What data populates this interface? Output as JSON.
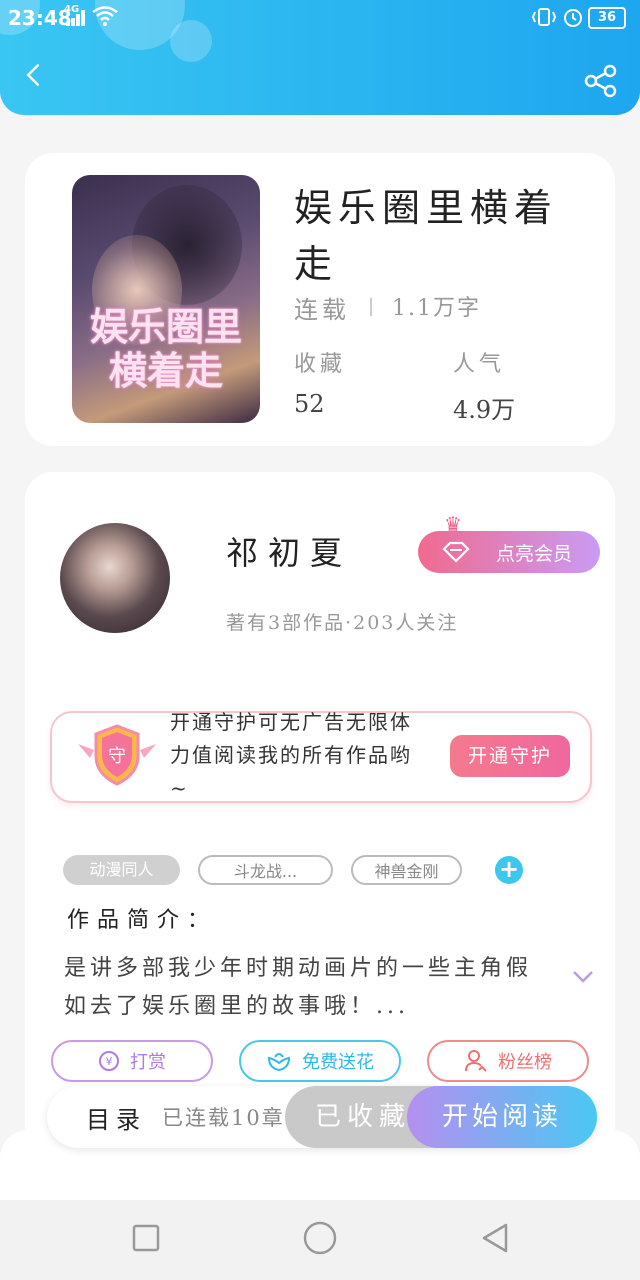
{
  "status_bar": {
    "time": "23:48",
    "network": "4G",
    "battery": "36"
  },
  "book": {
    "cover_title": "娱乐圈里横着走",
    "title": "娱乐圈里横着走",
    "status": "连载",
    "word_count": "1.1万字",
    "stats": {
      "favorites_label": "收藏",
      "favorites_value": "52",
      "popularity_label": "人气",
      "popularity_value": "4.9万"
    }
  },
  "author": {
    "name": "祁初夏",
    "info": "著有3部作品·203人关注",
    "vip_button": "点亮会员"
  },
  "guard": {
    "shield_char": "守",
    "text": "开通守护可无广告无限体力值阅读我的所有作品哟~",
    "button": "开通守护"
  },
  "tags": [
    "动漫同人",
    "斗龙战...",
    "神兽金刚"
  ],
  "intro": {
    "title": "作品简介：",
    "text": "是讲多部我少年时期动画片的一些主角假如去了娱乐圈里的故事哦！..."
  },
  "actions": {
    "reward": "打赏",
    "flower": "免费送花",
    "fans": "粉丝榜"
  },
  "bottom_bar": {
    "catalog_label": "目录",
    "catalog_count": "已连载10章",
    "favorite_button": "已收藏",
    "read_button": "开始阅读"
  },
  "colors": {
    "header": "#1ea6ef",
    "accent_pink": "#f06a8e",
    "accent_blue": "#49c8f2"
  }
}
